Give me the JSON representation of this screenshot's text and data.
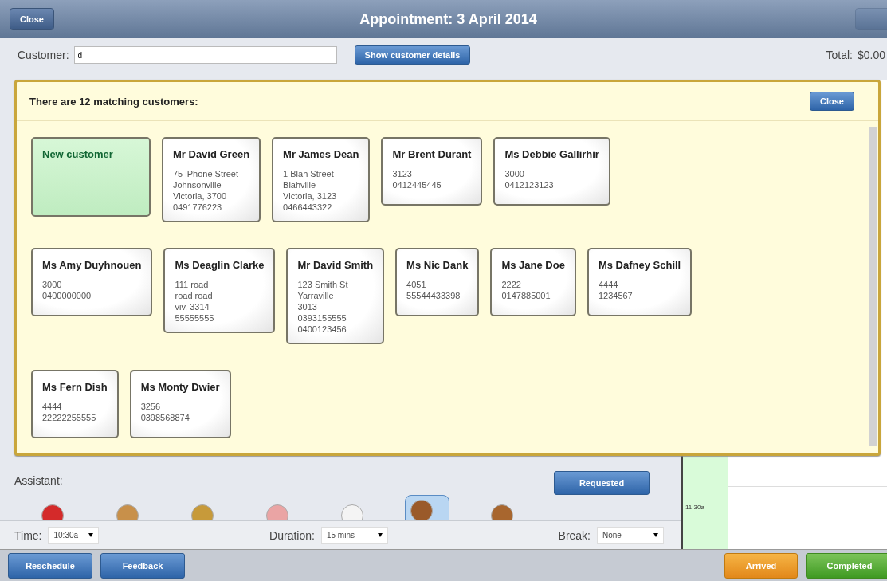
{
  "header": {
    "close": "Close",
    "title": "Appointment: 3 April 2014",
    "action_disabled": true
  },
  "customer": {
    "label": "Customer:",
    "value": "d",
    "details_button": "Show customer details",
    "total_label": "Total:",
    "total": "$0.00"
  },
  "matches": {
    "heading": "There are 12 matching customers:",
    "close": "Close",
    "cards": [
      {
        "kind": "new",
        "name": "New customer"
      },
      {
        "kind": "customer",
        "name": "Mr David Green",
        "lines": [
          "75 iPhone Street",
          "Johnsonville",
          "Victoria, 3700",
          "0491776223"
        ]
      },
      {
        "kind": "customer",
        "name": "Mr James Dean",
        "lines": [
          "1 Blah Street",
          "Blahville",
          "Victoria, 3123",
          "0466443322"
        ]
      },
      {
        "kind": "customer",
        "name": "Mr Brent Durant",
        "lines": [
          "3123",
          "0412445445"
        ]
      },
      {
        "kind": "customer",
        "name": "Ms Debbie Gallirhir",
        "lines": [
          "3000",
          "0412123123"
        ]
      },
      {
        "kind": "break"
      },
      {
        "kind": "customer",
        "name": "Ms Amy Duyhnouen",
        "lines": [
          "3000",
          "0400000000"
        ]
      },
      {
        "kind": "customer",
        "name": "Ms Deaglin Clarke",
        "lines": [
          "111 road",
          "road road",
          "viv, 3314",
          "55555555"
        ]
      },
      {
        "kind": "customer",
        "name": "Mr David Smith",
        "lines": [
          "123 Smith St",
          "Yarraville",
          "3013",
          "0393155555",
          "0400123456"
        ]
      },
      {
        "kind": "customer",
        "name": "Ms Nic Dank",
        "lines": [
          "4051",
          "55544433398"
        ]
      },
      {
        "kind": "customer",
        "name": "Ms Jane Doe",
        "lines": [
          "2222",
          "0147885001"
        ]
      },
      {
        "kind": "customer",
        "name": "Ms Dafney Schill",
        "lines": [
          "4444",
          "1234567"
        ]
      },
      {
        "kind": "break"
      },
      {
        "kind": "customer",
        "name": "Ms Fern Dish",
        "lines": [
          "4444",
          "22222255555"
        ]
      },
      {
        "kind": "customer",
        "name": "Ms Monty Dwier",
        "lines": [
          "3256",
          "0398568874"
        ]
      }
    ]
  },
  "assistant": {
    "label": "Assistant:",
    "requested": "Requested",
    "avatars": [
      {
        "color": "#d42a2a",
        "selected": false
      },
      {
        "color": "#c8904a",
        "selected": false
      },
      {
        "color": "#c79a3a",
        "selected": false
      },
      {
        "color": "#eaa4a4",
        "selected": false
      },
      {
        "color": "#f4f4f4",
        "selected": false
      },
      {
        "color": "#9a5a2a",
        "selected": true
      },
      {
        "color": "#a8662e",
        "selected": false
      }
    ]
  },
  "time_row": {
    "time_label": "Time:",
    "time": "10:30a",
    "duration_label": "Duration:",
    "duration": "15 mins",
    "break_label": "Break:",
    "break": "None"
  },
  "schedule": {
    "slot": "11:30a"
  },
  "footer": {
    "left": [
      "Reschedule",
      "Feedback"
    ],
    "arrived": "Arrived",
    "completed": "Completed"
  }
}
